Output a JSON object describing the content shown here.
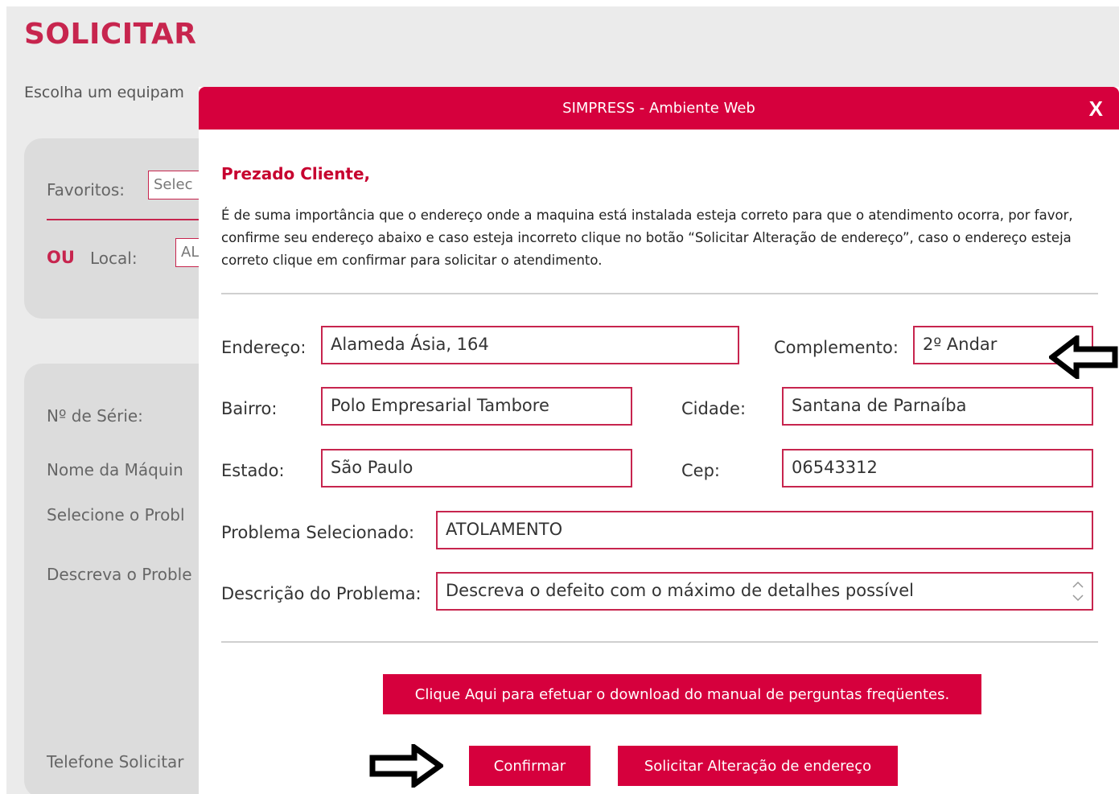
{
  "background": {
    "page_title": "SOLICITAR",
    "intro_text": "Escolha um equipam",
    "favoritos_label": "Favoritos:",
    "favoritos_value": "Selec",
    "ou_label": "OU",
    "local_label": "Local:",
    "local_value": "AL",
    "serie_label": "Nº de Série:",
    "nome_label": "Nome da Máquin",
    "selecione_label": "Selecione o Probl",
    "descreva_label": "Descreva o Proble",
    "telefone_label": "Telefone Solicitar"
  },
  "modal": {
    "title": "SIMPRESS - Ambiente Web",
    "close_label": "X",
    "greeting": "Prezado Cliente,",
    "message": "É de suma importância que o endereço onde a maquina está instalada esteja correto para que o atendimento ocorra, por favor, confirme seu endereço abaixo e caso esteja incorreto clique no botão “Solicitar Alteração de endereço”, caso o endereço esteja correto clique em confirmar para solicitar o atendimento.",
    "fields": {
      "endereco": {
        "label": "Endereço:",
        "value": "Alameda Ásia, 164"
      },
      "complemento": {
        "label": "Complemento:",
        "value": "2º Andar"
      },
      "bairro": {
        "label": "Bairro:",
        "value": "Polo Empresarial Tambore"
      },
      "cidade": {
        "label": "Cidade:",
        "value": "Santana de Parnaíba"
      },
      "estado": {
        "label": "Estado:",
        "value": "São Paulo"
      },
      "cep": {
        "label": "Cep:",
        "value": "06543312"
      },
      "problema": {
        "label": "Problema Selecionado:",
        "value": "ATOLAMENTO"
      },
      "descricao": {
        "label": "Descrição do Problema:",
        "placeholder": "Descreva o defeito com o máximo de detalhes possível"
      }
    },
    "download_button": "Clique Aqui para efetuar o download do manual de perguntas freqüentes.",
    "confirm_button": "Confirmar",
    "change_address_button": "Solicitar Alteração de endereço"
  },
  "colors": {
    "brand": "#d6003d",
    "field_border": "#c7254e",
    "overlay_bg": "#ebebeb"
  },
  "icons": [
    "close-icon",
    "arrow-left-icon",
    "arrow-right-icon",
    "scroll-arrows-icon"
  ]
}
